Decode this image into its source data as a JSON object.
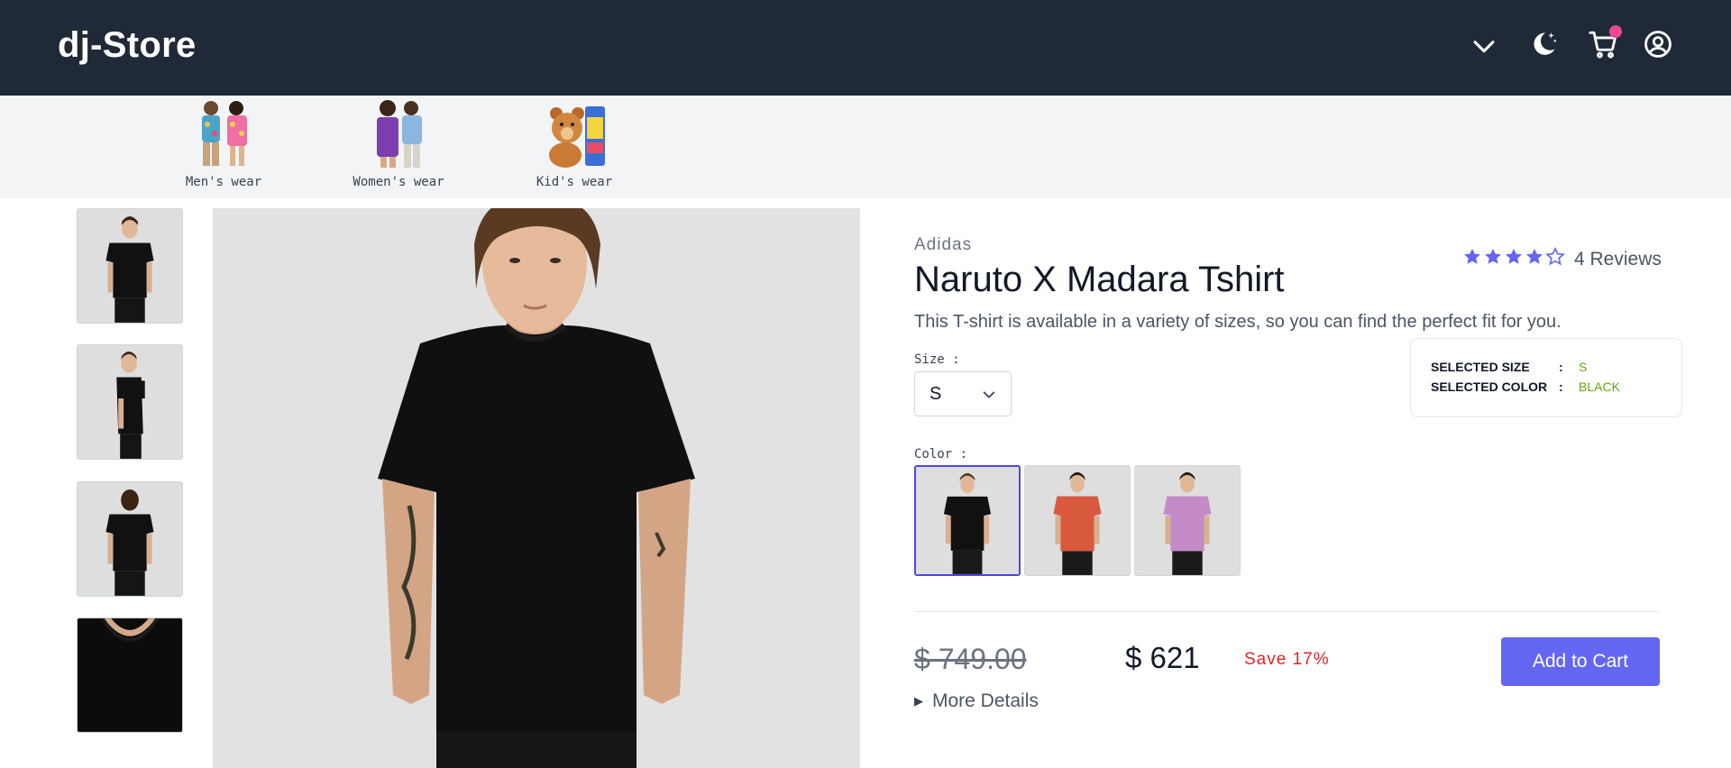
{
  "header": {
    "brand": "dj-Store",
    "icons": [
      "chevron-down-icon",
      "moon-stars-icon",
      "cart-icon",
      "user-circle-icon"
    ],
    "colors": {
      "background": "#1f2937",
      "cart_badge": "#ec4899"
    }
  },
  "categories": [
    {
      "label": "Men's wear",
      "icon": "mens-wear-image"
    },
    {
      "label": "Women's wear",
      "icon": "womens-wear-image"
    },
    {
      "label": "Kid's wear",
      "icon": "kids-wear-image"
    }
  ],
  "gallery": {
    "thumbnails": [
      "front-view",
      "side-view",
      "back-view",
      "fabric-closeup"
    ]
  },
  "product": {
    "brand": "Adidas",
    "title": "Naruto X Madara Tshirt",
    "rating": 4,
    "rating_max": 5,
    "reviews": "4 Reviews",
    "description": "This T-shirt is available in a variety of sizes, so you can find the perfect fit for you.",
    "size_label": "Size :",
    "size_value": "S",
    "color_label": "Color :",
    "colors": [
      {
        "name": "black",
        "hex": "#111111"
      },
      {
        "name": "orange",
        "hex": "#d9593f"
      },
      {
        "name": "purple",
        "hex": "#c48bc8"
      }
    ],
    "selected": {
      "size_key": "SELECTED SIZE",
      "size_val": "S",
      "color_key": "SELECTED COLOR",
      "color_val": "BLACK",
      "sep": ":"
    },
    "old_price": "$ 749.00",
    "new_price": "$ 621",
    "save": "Save 17%",
    "add_to_cart": "Add to Cart",
    "more_details": "More Details",
    "accent": "#6366f1"
  }
}
